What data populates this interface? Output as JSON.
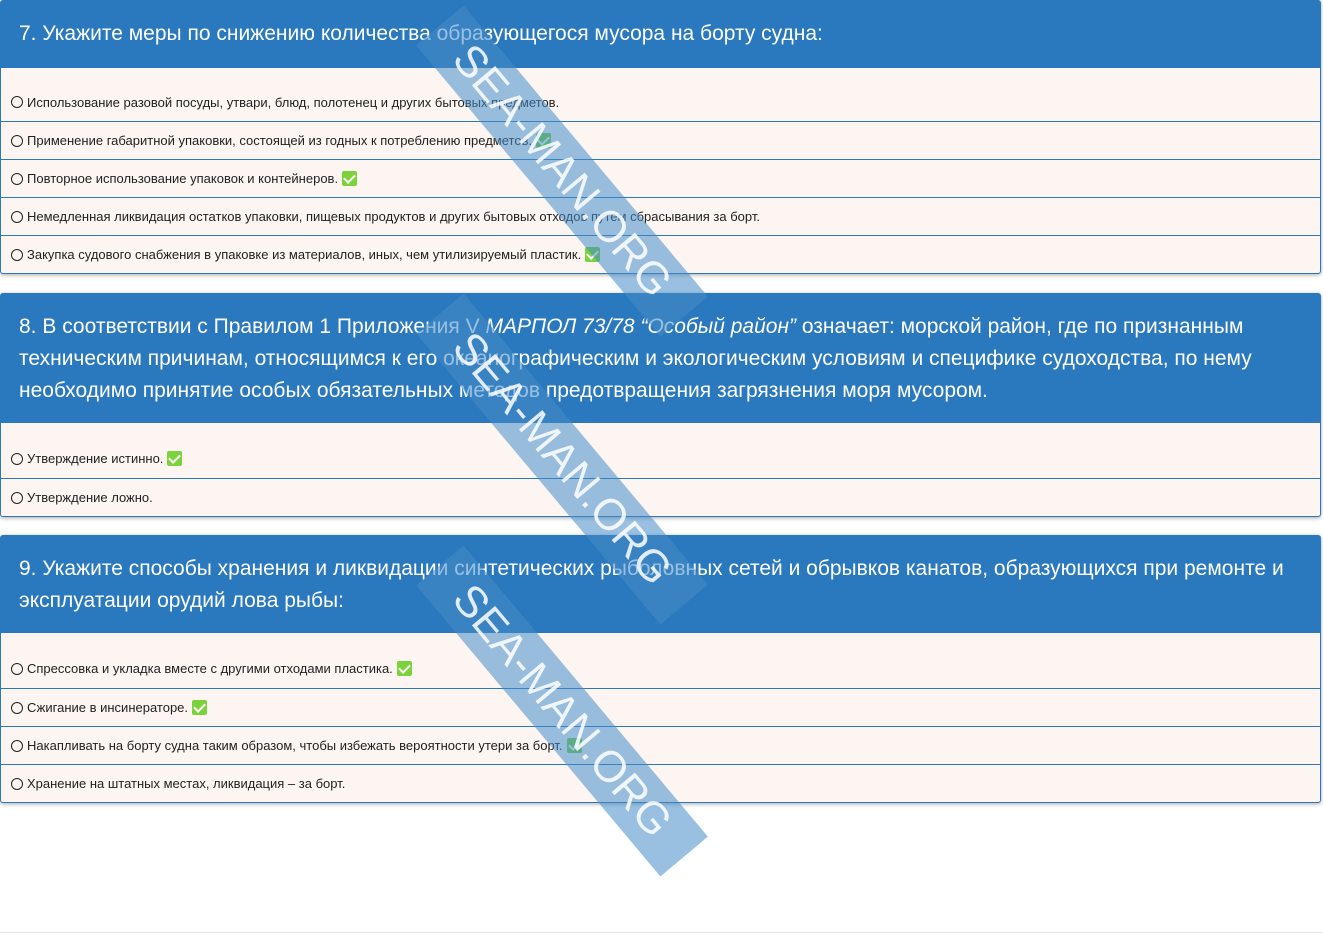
{
  "questions": [
    {
      "title": "7. Укажите меры по снижению количества образующегося мусора на борту судна:",
      "answers": [
        {
          "text": "Использование разовой посуды, утвари, блюд, полотенец и других бытовых предметов.",
          "correct": false
        },
        {
          "text": "Применение габаритной упаковки, состоящей из годных к потреблению предметов.",
          "correct": true
        },
        {
          "text": "Повторное использование упаковок и контейнеров.",
          "correct": true
        },
        {
          "text": "Немедленная ликвидация остатков упаковки, пищевых продуктов и других бытовых отходов путем сбрасывания за борт.",
          "correct": false
        },
        {
          "text": "Закупка судового снабжения в упаковке из материалов, иных, чем утилизируемый пластик.",
          "correct": true
        }
      ]
    },
    {
      "title_part1": "8. В соответствии с Правилом 1 Приложения V ",
      "title_italic": "МАРПОЛ 73/78 “Особый район”",
      "title_part2": " означает: морской район, где по признанным техническим причинам, относящимся к его океанографическим и экологическим условиям и специфике судоходства, по нему необходимо принятие особых обязательных методов предотвращения загрязнения моря мусором.",
      "answers": [
        {
          "text": "Утверждение истинно.",
          "correct": true
        },
        {
          "text": "Утверждение ложно.",
          "correct": false
        }
      ]
    },
    {
      "title": "9. Укажите способы хранения и ликвидации синтетических рыболовных сетей и обрывков канатов, образующихся при ремонте и эксплуатации орудий лова рыбы:",
      "answers": [
        {
          "text": "Спрессовка и укладка вместе с другими отходами пластика.",
          "correct": true
        },
        {
          "text": "Сжигание в инсинераторе.",
          "correct": true
        },
        {
          "text": "Накапливать на борту судна таким образом, чтобы избежать вероятности утери за борт.",
          "correct": true
        },
        {
          "text": "Хранение на штатных местах, ликвидация – за борт.",
          "correct": false
        }
      ]
    }
  ],
  "watermark": "SEA-MAN.ORG",
  "colors": {
    "header": "#2a78bd",
    "answer_bg": "#fdf5f1",
    "check": "#7bd33b"
  }
}
